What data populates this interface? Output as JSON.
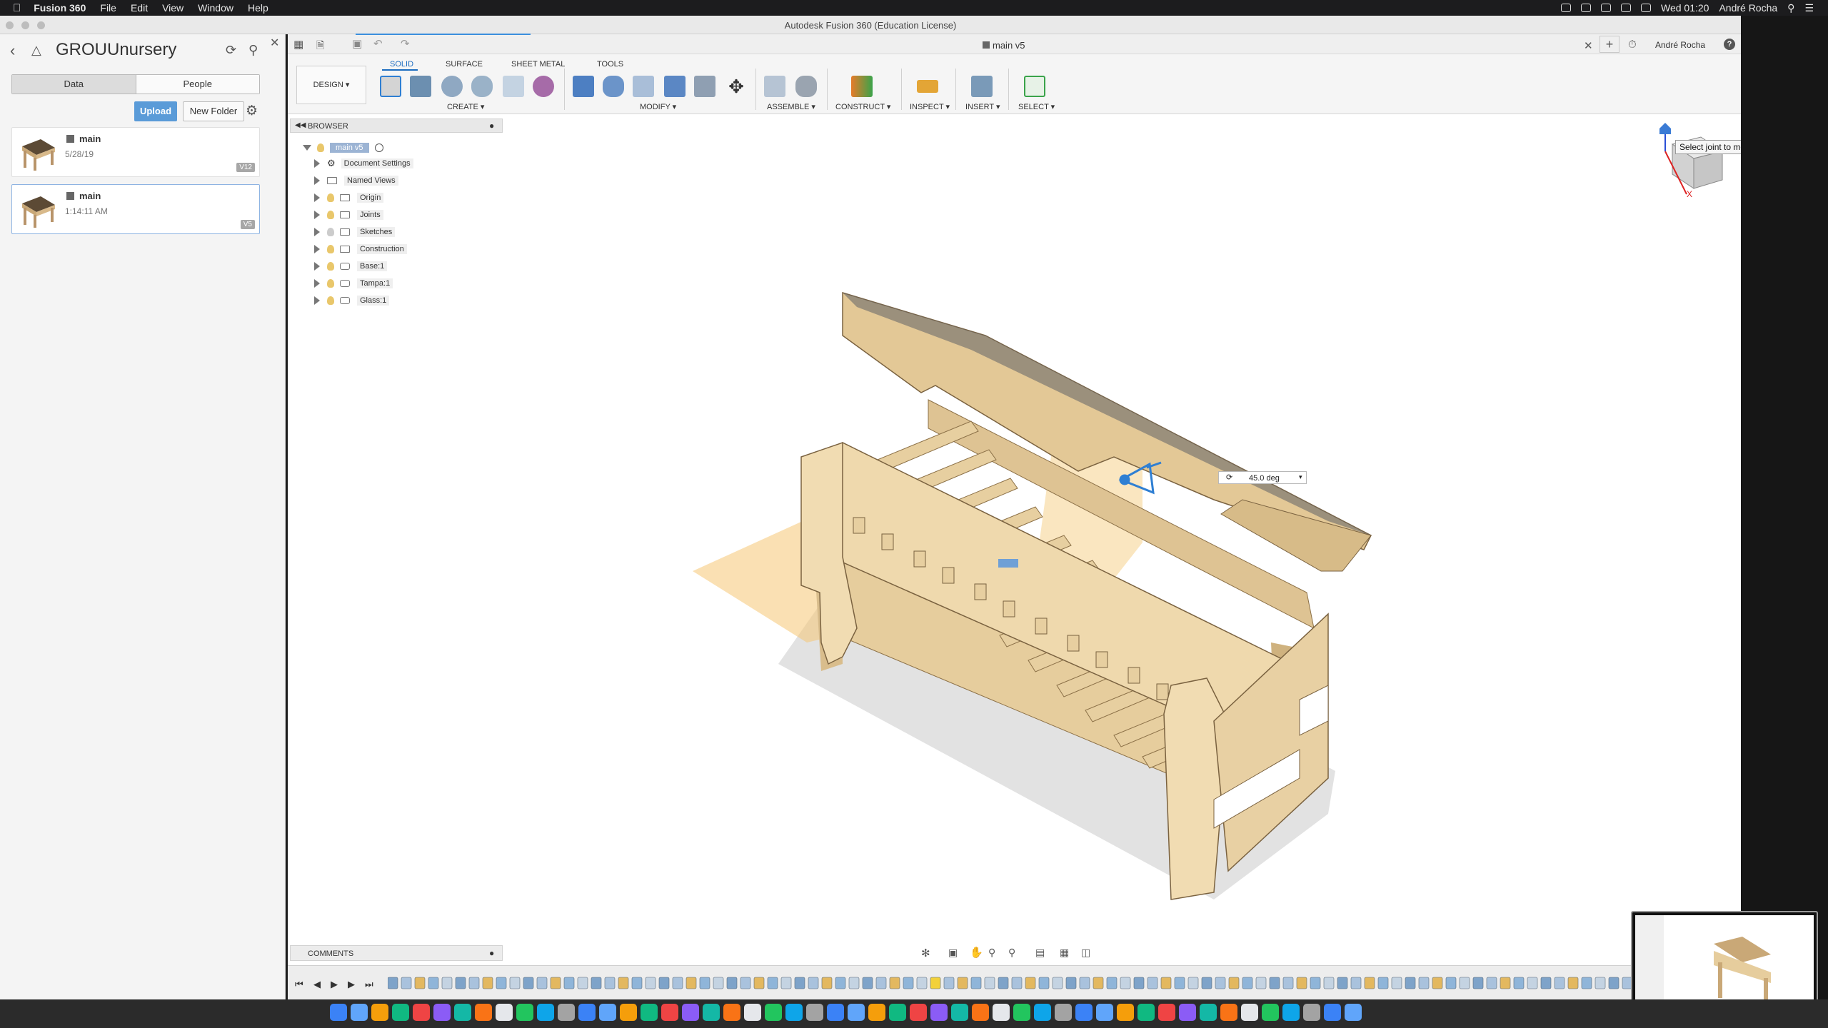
{
  "menubar": {
    "app_name": "Fusion 360",
    "items": [
      "File",
      "Edit",
      "View",
      "Window",
      "Help"
    ],
    "clock": "Wed 01:20",
    "user": "André Rocha"
  },
  "window": {
    "title": "Autodesk Fusion 360 (Education License)"
  },
  "data_panel": {
    "project_title": "GROUUnursery",
    "tabs": [
      "Data",
      "People"
    ],
    "upload_label": "Upload",
    "new_folder_label": "New Folder",
    "files": [
      {
        "name": "main",
        "date": "5/28/19",
        "version": "V12"
      },
      {
        "name": "main",
        "date": "1:14:11 AM",
        "version": "V5"
      }
    ]
  },
  "document": {
    "tab_title": "main v5",
    "user": "André Rocha",
    "help": "?"
  },
  "ribbon": {
    "tabs": [
      "SOLID",
      "SURFACE",
      "SHEET METAL",
      "TOOLS"
    ],
    "active_tab": "SOLID",
    "workspace": "DESIGN",
    "groups": [
      "CREATE",
      "MODIFY",
      "ASSEMBLE",
      "CONSTRUCT",
      "INSPECT",
      "INSERT",
      "SELECT"
    ]
  },
  "browser": {
    "header": "BROWSER",
    "root": "main v5",
    "items": [
      {
        "label": "Document Settings",
        "icon": "gear-icon",
        "bulb": false
      },
      {
        "label": "Named Views",
        "icon": "folder-icon",
        "bulb": false
      },
      {
        "label": "Origin",
        "icon": "folder-icon",
        "bulb": true
      },
      {
        "label": "Joints",
        "icon": "folder-icon",
        "bulb": true
      },
      {
        "label": "Sketches",
        "icon": "folder-icon",
        "bulb": true
      },
      {
        "label": "Construction",
        "icon": "folder-icon",
        "bulb": true
      },
      {
        "label": "Base:1",
        "icon": "component-icon",
        "bulb": true
      },
      {
        "label": "Tampa:1",
        "icon": "component-icon",
        "bulb": true
      },
      {
        "label": "Glass:1",
        "icon": "component-icon",
        "bulb": true
      }
    ]
  },
  "canvas": {
    "tooltip": "Select joint to modify",
    "angle_value": "45.0 deg"
  },
  "comments": {
    "label": "COMMENTS"
  },
  "colors": {
    "accent": "#1c6cc0",
    "upload": "#5a9bd8",
    "wood": "#e8cf9a",
    "construction_plane": "#f5c774"
  }
}
